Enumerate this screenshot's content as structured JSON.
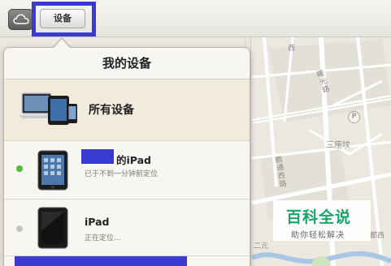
{
  "topbar": {
    "cloud_icon": "icloud-icon",
    "devices_button_label": "设备"
  },
  "panel": {
    "title": "我的设备",
    "all_devices_label": "所有设备",
    "devices": [
      {
        "name": "的iPad",
        "status": "已于不到一分钟前定位",
        "status_color": "#4bbd3a"
      },
      {
        "name": "iPad",
        "status": "正在定位...",
        "status_color": "#c8c6c0"
      }
    ]
  },
  "map": {
    "labels": [
      "西",
      "曙光路",
      "三座坟",
      "鹏通西路",
      "二元",
      "都西"
    ],
    "poi_p": "P"
  },
  "watermark": {
    "title": "百科全说",
    "subtitle": "助你轻松解决"
  }
}
